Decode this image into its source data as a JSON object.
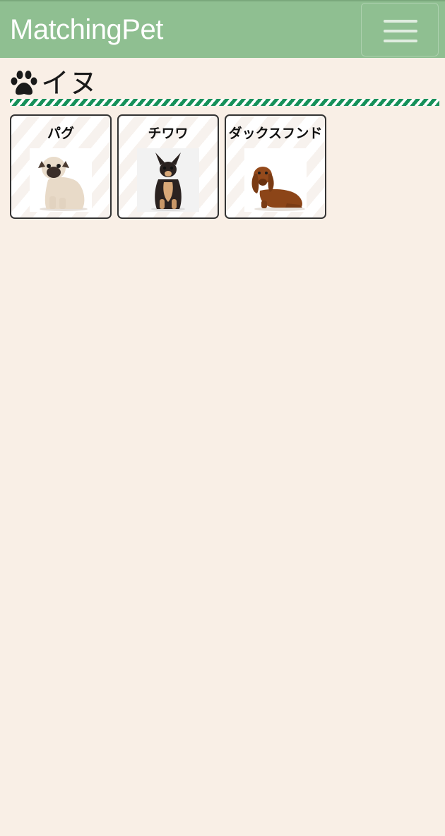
{
  "navbar": {
    "brand": "MatchingPet",
    "menu_icon": "hamburger-menu-icon"
  },
  "category": {
    "icon": "paw-icon",
    "title": "イヌ"
  },
  "breeds": [
    {
      "name": "パグ",
      "image": "pug-photo"
    },
    {
      "name": "チワワ",
      "image": "chihuahua-photo"
    },
    {
      "name": "ダックスフンド",
      "image": "dachshund-photo"
    }
  ],
  "colors": {
    "navbar_bg": "#8fbf91",
    "page_bg": "#f9efe6",
    "stripe_green": "#16915a"
  }
}
